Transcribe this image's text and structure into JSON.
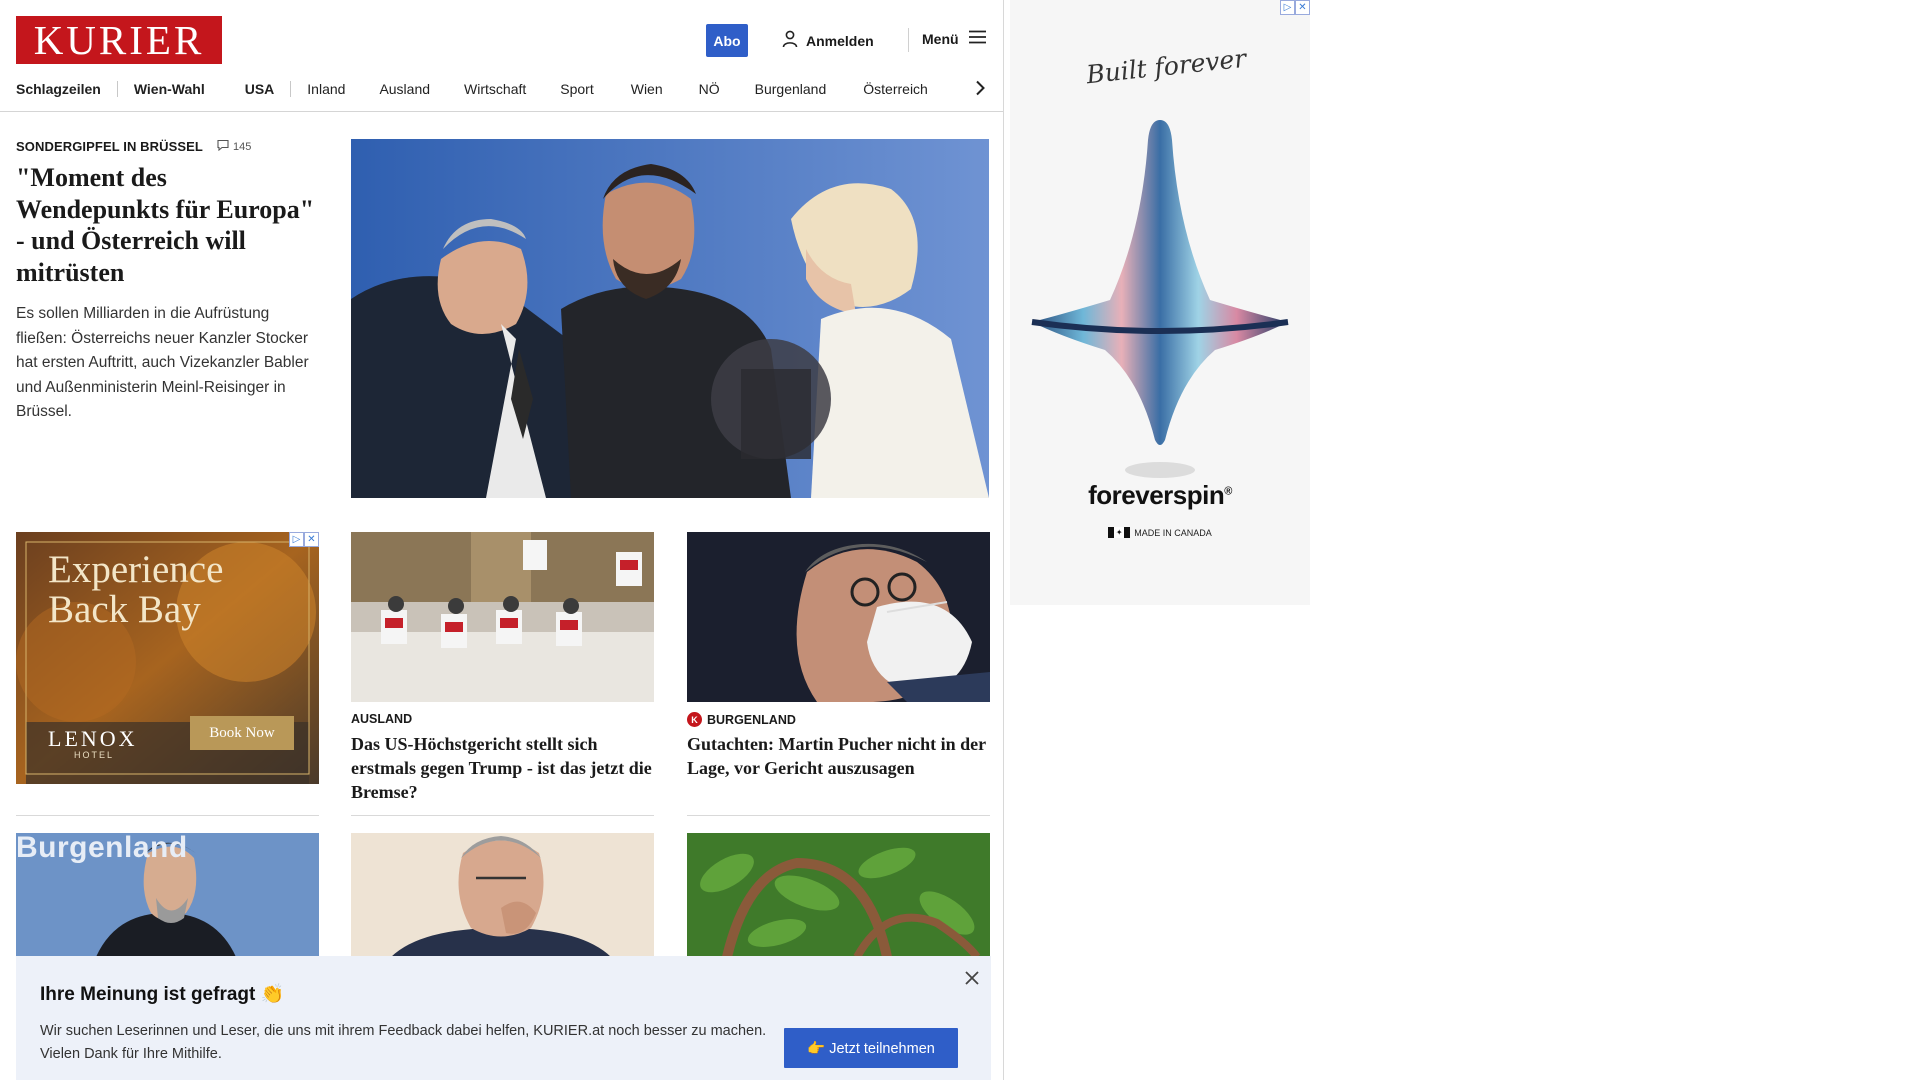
{
  "header": {
    "logo": "KURIER",
    "abo_label": "Abo",
    "login_label": "Anmelden",
    "menu_label": "Menü"
  },
  "nav": {
    "items": [
      "Schlagzeilen",
      "Wien-Wahl",
      "USA",
      "Inland",
      "Ausland",
      "Wirtschaft",
      "Sport",
      "Wien",
      "NÖ",
      "Burgenland",
      "Österreich"
    ]
  },
  "lead": {
    "kicker": "SONDERGIPFEL IN BRÜSSEL",
    "comments": "145",
    "headline": "\"Moment des Wendepunkts für Europa\" - und Österreich will mitrüsten",
    "teaser": "Es sollen Milliarden in die Aufrüstung fließen: Österreichs neuer Kanzler Stocker hat ersten Auftritt, auch Vizekanzler Babler und Außenministerin Meinl-Reisinger in Brüssel."
  },
  "ad_small": {
    "title": "Experience Back Bay",
    "brand": "LENOX",
    "sub": "HOTEL",
    "cta": "Book Now"
  },
  "tiles": [
    {
      "kicker": "AUSLAND",
      "headline": "Das US-Höchstgericht stellt sich erstmals gegen Trump - ist das jetzt die Bremse?"
    },
    {
      "kicker": "BURGENLAND",
      "headline": "Gutachten: Martin Pucher nicht in der Lage, vor Gericht auszusagen"
    }
  ],
  "row3": {
    "left_caption": "Burgenland"
  },
  "survey": {
    "title": "Ihre Meinung ist gefragt 👏",
    "text": "Wir suchen Leserinnen und Leser, die uns mit ihrem Feedback dabei helfen, KURIER.at noch besser zu machen. Vielen Dank für Ihre Mithilfe.",
    "button": "👉 Jetzt teilnehmen"
  },
  "side_ad": {
    "script": "Built forever",
    "brand": "foreverspin",
    "registered": "®",
    "made": "MADE IN CANADA"
  },
  "colors": {
    "brand_red": "#c4161c",
    "accent_blue": "#2f5ec8",
    "survey_bg": "#edf1f9"
  }
}
